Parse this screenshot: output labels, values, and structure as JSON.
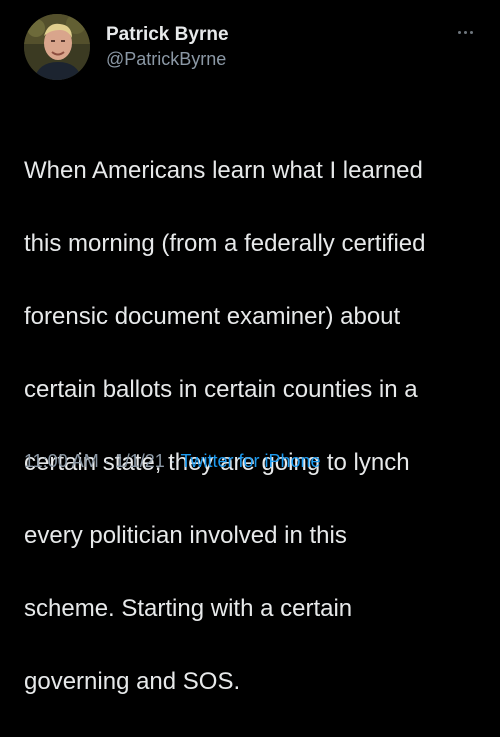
{
  "author": {
    "display_name": "Patrick Byrne",
    "handle": "@PatrickByrne",
    "avatar_icon": "profile-photo"
  },
  "tweet": {
    "lines": [
      "When Americans learn what I learned",
      "this morning (from a federally certified",
      "forensic document examiner) about",
      "certain ballots in certain counties in a",
      "certain state, they are going to lynch",
      "every politician involved in this",
      "scheme. Starting with a certain",
      "governing and SOS."
    ]
  },
  "meta": {
    "time": "11:00 AM",
    "separator": "·",
    "date": "1/1/21",
    "source": "Twitter for iPhone"
  },
  "colors": {
    "background": "#000000",
    "text": "#e7e9ea",
    "secondary": "#8b98a5",
    "link": "#1d9bf0"
  },
  "icons": {
    "more": "more-horizontal-icon"
  }
}
